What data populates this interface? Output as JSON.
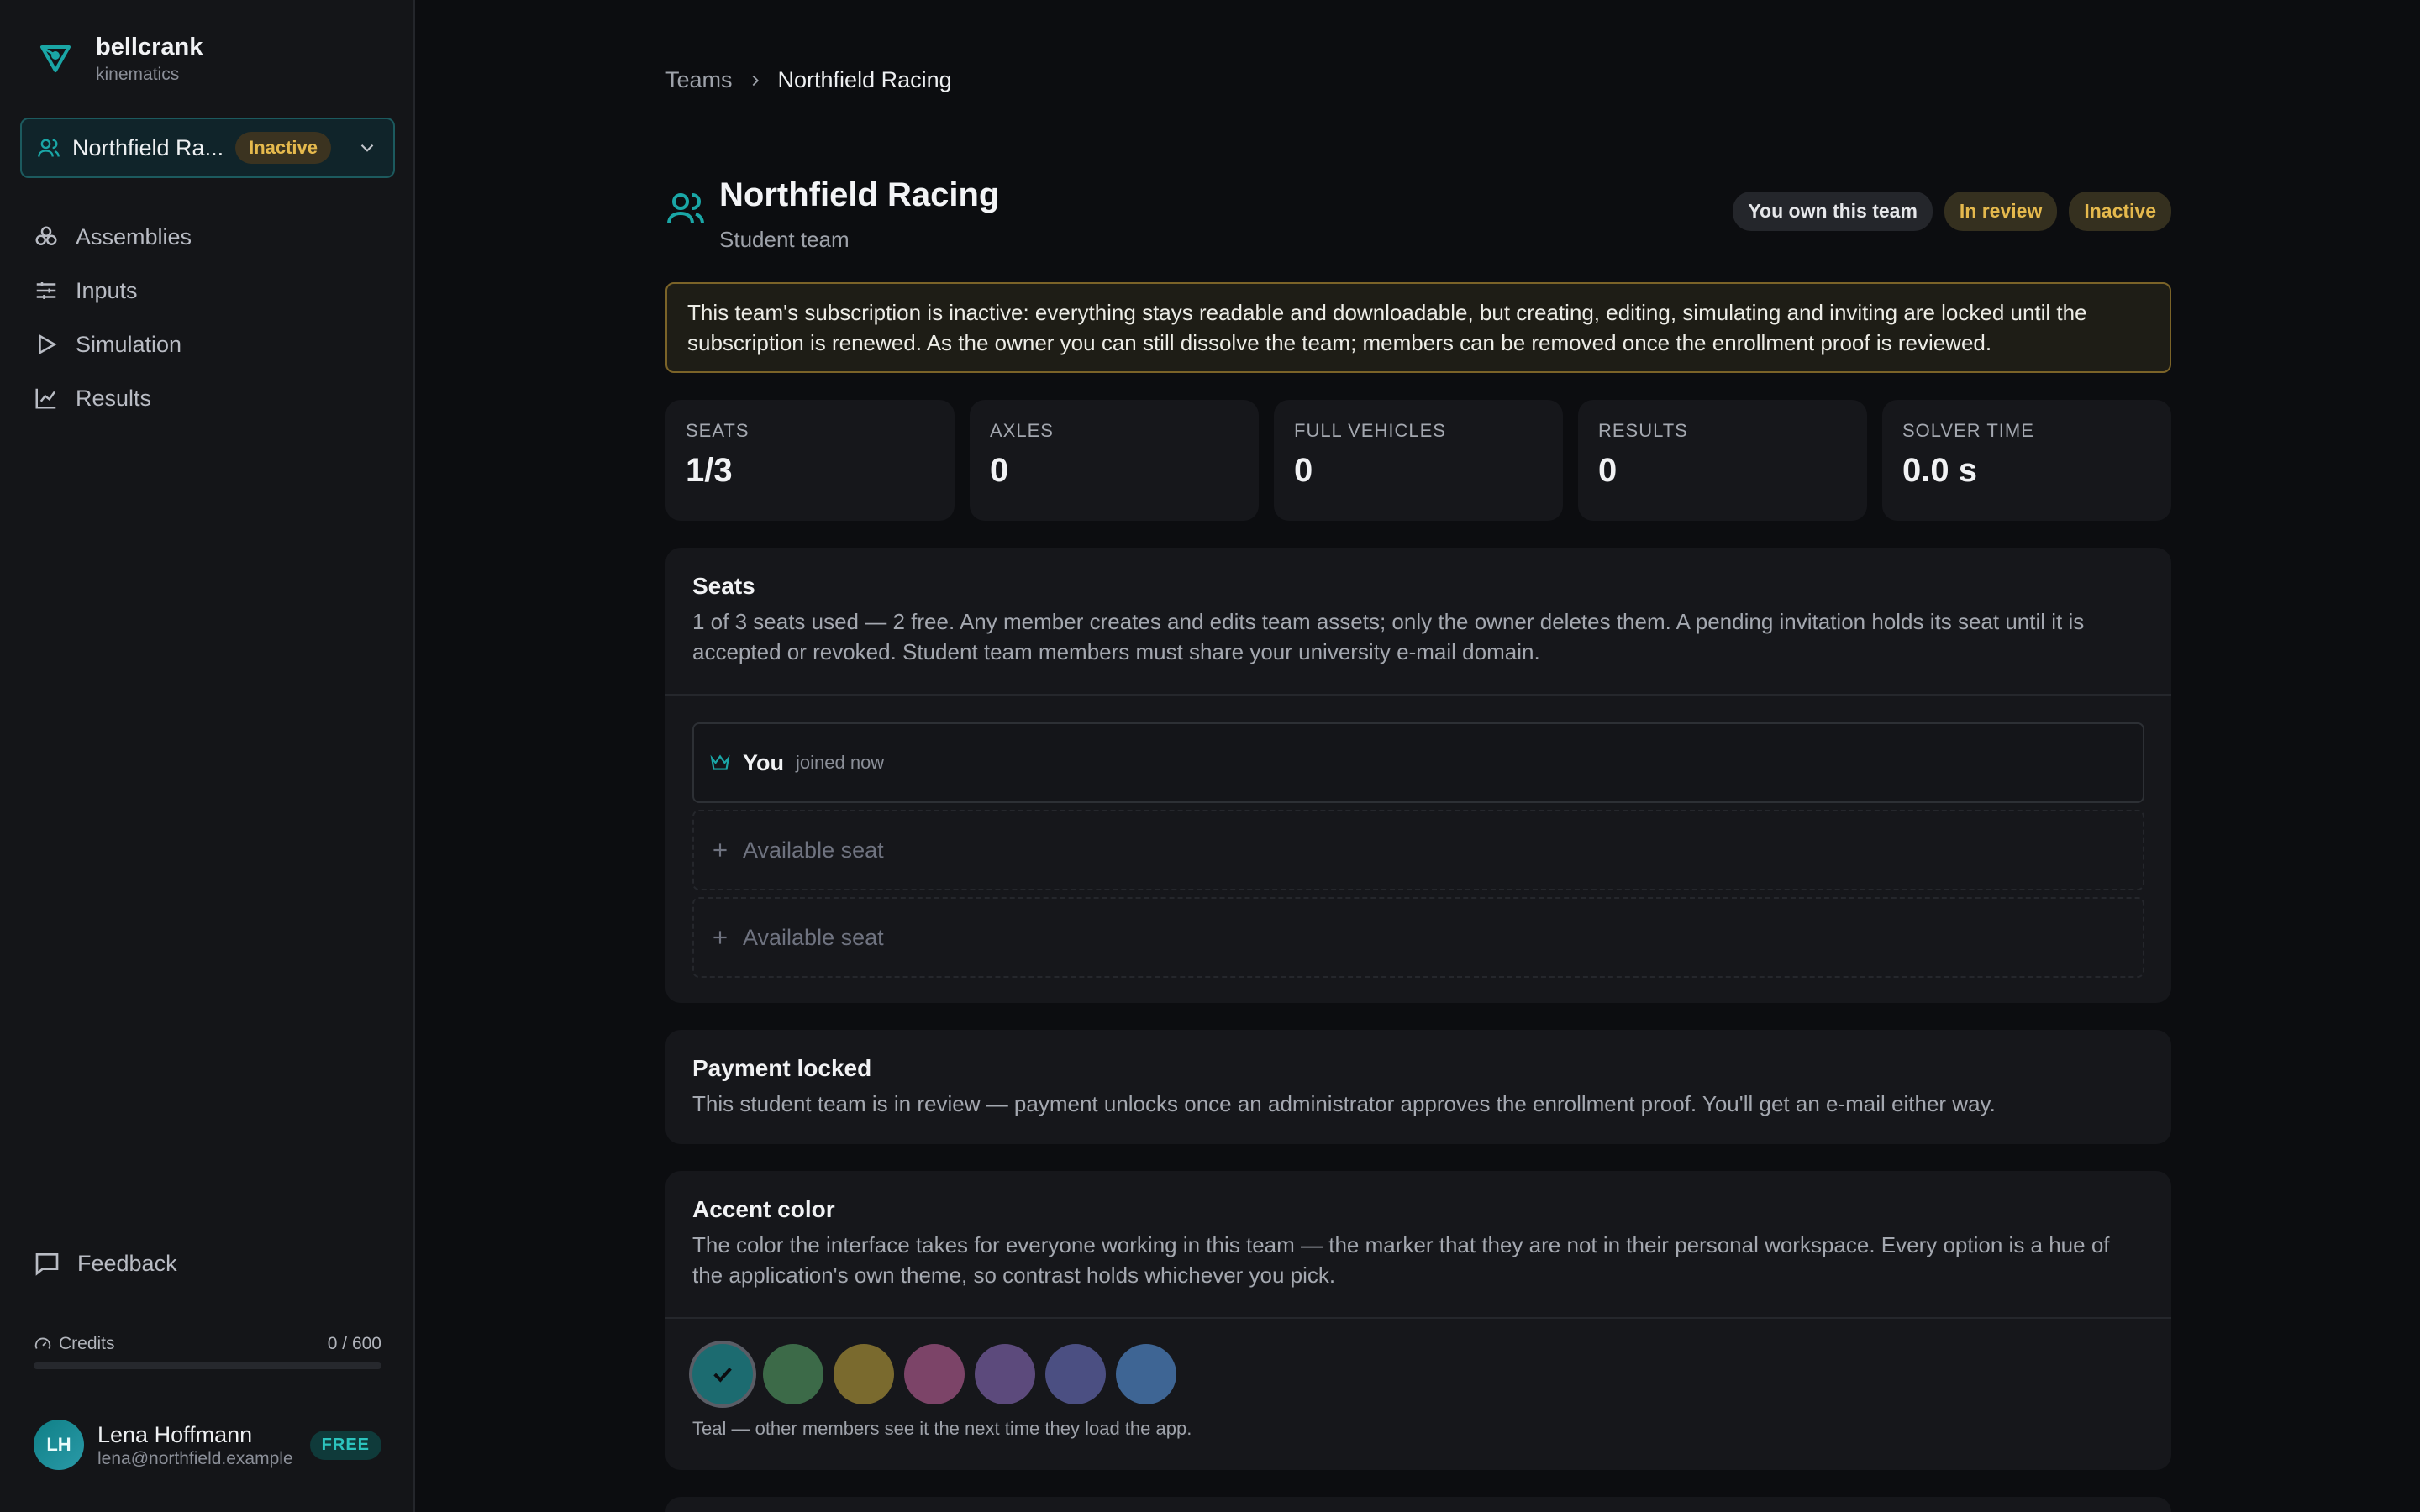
{
  "brand": {
    "name": "bellcrank",
    "sub": "kinematics"
  },
  "team_switcher": {
    "name": "Northfield Ra...",
    "status": "Inactive"
  },
  "nav": {
    "items": [
      {
        "label": "Assemblies",
        "icon": "assemblies-icon"
      },
      {
        "label": "Inputs",
        "icon": "sliders-icon"
      },
      {
        "label": "Simulation",
        "icon": "play-icon"
      },
      {
        "label": "Results",
        "icon": "chart-icon"
      }
    ]
  },
  "feedback": {
    "label": "Feedback"
  },
  "credits": {
    "label": "Credits",
    "value": "0 / 600",
    "used_fraction": 0
  },
  "user": {
    "initials": "LH",
    "name": "Lena Hoffmann",
    "email": "lena@northfield.example",
    "plan": "FREE"
  },
  "breadcrumb": {
    "parent": "Teams",
    "current": "Northfield Racing"
  },
  "header": {
    "title": "Northfield Racing",
    "subtitle": "Student team",
    "tags": {
      "own": "You own this team",
      "review": "In review",
      "inactive": "Inactive"
    }
  },
  "warning": "This team's subscription is inactive: everything stays readable and downloadable, but creating, editing, simulating and inviting are locked until the subscription is renewed. As the owner you can still dissolve the team; members can be removed once the enrollment proof is reviewed.",
  "stats": [
    {
      "label": "SEATS",
      "value": "1/3"
    },
    {
      "label": "AXLES",
      "value": "0"
    },
    {
      "label": "FULL VEHICLES",
      "value": "0"
    },
    {
      "label": "RESULTS",
      "value": "0"
    },
    {
      "label": "SOLVER TIME",
      "value": "0.0 s"
    }
  ],
  "seats": {
    "title": "Seats",
    "desc": "1 of 3 seats used — 2 free. Any member creates and edits team assets; only the owner deletes them. A pending invitation holds its seat until it is accepted or revoked. Student team members must share your university e-mail domain.",
    "me": {
      "name": "You",
      "joined": "joined now"
    },
    "empty_label": "Available seat"
  },
  "payment": {
    "title": "Payment locked",
    "desc": "This student team is in review — payment unlocks once an administrator approves the enrollment proof. You'll get an e-mail either way."
  },
  "accent": {
    "title": "Accent color",
    "desc": "The color the interface takes for everyone working in this team — the marker that they are not in their personal workspace. Every option is a hue of the application's own theme, so contrast holds whichever you pick.",
    "swatches": [
      "#1c6b70",
      "#3c6a48",
      "#7a6a2e",
      "#7c4468",
      "#5c4a7c",
      "#4b4f82",
      "#3e6594"
    ],
    "selected_index": 0,
    "note": "Teal — other members see it the next time they load the app."
  },
  "colors": {
    "accent": "#1aa6a6",
    "warning_border": "#7b6328",
    "warning_text": "#e5b94d"
  }
}
